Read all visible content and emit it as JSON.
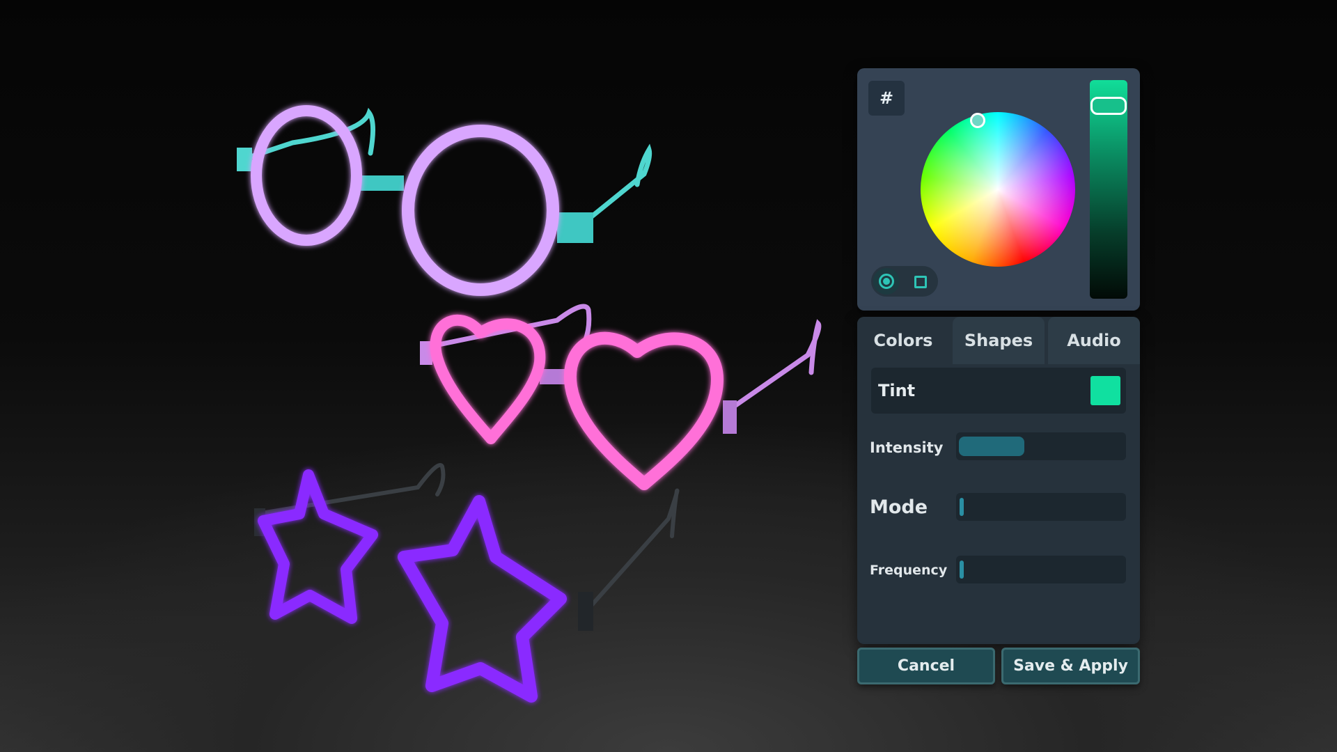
{
  "scene": {
    "items": [
      {
        "name": "round glow glasses",
        "frame_color": "#d9a6ff",
        "arm_color": "#4fd6cf"
      },
      {
        "name": "heart glow glasses",
        "frame_color": "#ff6fd8",
        "arm_color": "#cc88ee"
      },
      {
        "name": "star glow glasses",
        "frame_color": "#8a2cff",
        "arm_color": "#3a3f44"
      }
    ]
  },
  "picker": {
    "hex_label": "#",
    "selected_color": "#10e0a0",
    "shape_options": [
      "circle-icon",
      "square-icon"
    ],
    "selected_shape": "circle"
  },
  "tabs": [
    {
      "label": "Colors",
      "active": true
    },
    {
      "label": "Shapes",
      "active": false
    },
    {
      "label": "Audio",
      "active": false
    }
  ],
  "settings": {
    "tint_label": "Tint",
    "tint_color": "#10e0a0",
    "intensity_label": "Intensity",
    "intensity_value": 0.4,
    "mode_label": "Mode",
    "mode_value": 0.0,
    "frequency_label": "Frequency",
    "frequency_value": 0.0
  },
  "buttons": {
    "cancel": "Cancel",
    "save": "Save & Apply"
  }
}
